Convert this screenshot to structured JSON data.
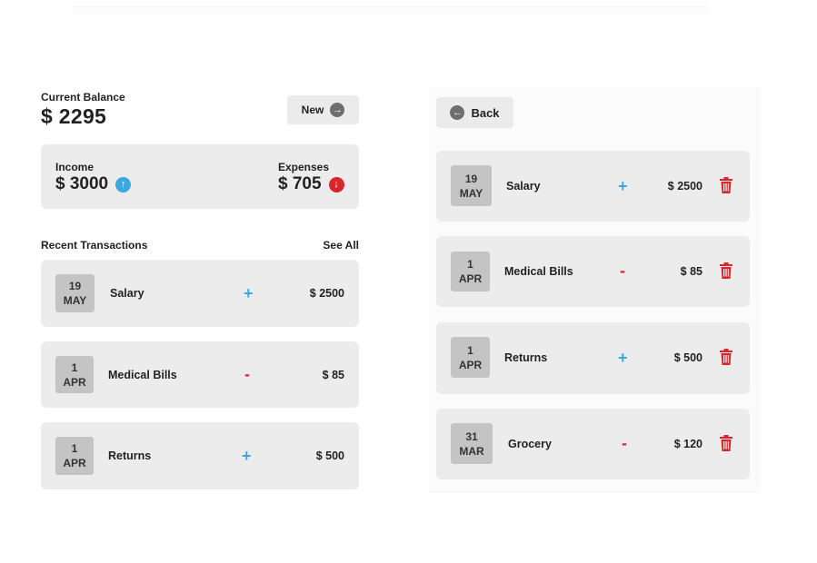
{
  "balance": {
    "label": "Current Balance",
    "value": "$ 2295"
  },
  "new_button": {
    "label": "New"
  },
  "income": {
    "label": "Income",
    "value": "$ 3000"
  },
  "expenses": {
    "label": "Expenses",
    "value": "$ 705"
  },
  "recent": {
    "title": "Recent Transactions",
    "see_all": "See All"
  },
  "left_transactions": [
    {
      "day": "19",
      "month": "MAY",
      "name": "Salary",
      "sign": "+",
      "amount": "$ 2500"
    },
    {
      "day": "1",
      "month": "APR",
      "name": "Medical Bills",
      "sign": "-",
      "amount": "$ 85"
    },
    {
      "day": "1",
      "month": "APR",
      "name": "Returns",
      "sign": "+",
      "amount": "$ 500"
    }
  ],
  "back_button": {
    "label": "Back"
  },
  "right_transactions": [
    {
      "day": "19",
      "month": "MAY",
      "name": "Salary",
      "sign": "+",
      "amount": "$ 2500"
    },
    {
      "day": "1",
      "month": "APR",
      "name": "Medical Bills",
      "sign": "-",
      "amount": "$ 85"
    },
    {
      "day": "1",
      "month": "APR",
      "name": "Returns",
      "sign": "+",
      "amount": "$ 500"
    },
    {
      "day": "31",
      "month": "MAR",
      "name": "Grocery",
      "sign": "-",
      "amount": "$ 120"
    }
  ],
  "icons": {
    "new": "arrow-right-circle-icon",
    "income": "arrow-up-circle-icon",
    "expenses": "arrow-down-circle-icon",
    "back": "arrow-left-circle-icon",
    "delete": "trash-icon"
  },
  "colors": {
    "positive": "#3ba8e0",
    "negative": "#d9262c",
    "card": "#ececec",
    "date_box": "#c4c4c4"
  }
}
